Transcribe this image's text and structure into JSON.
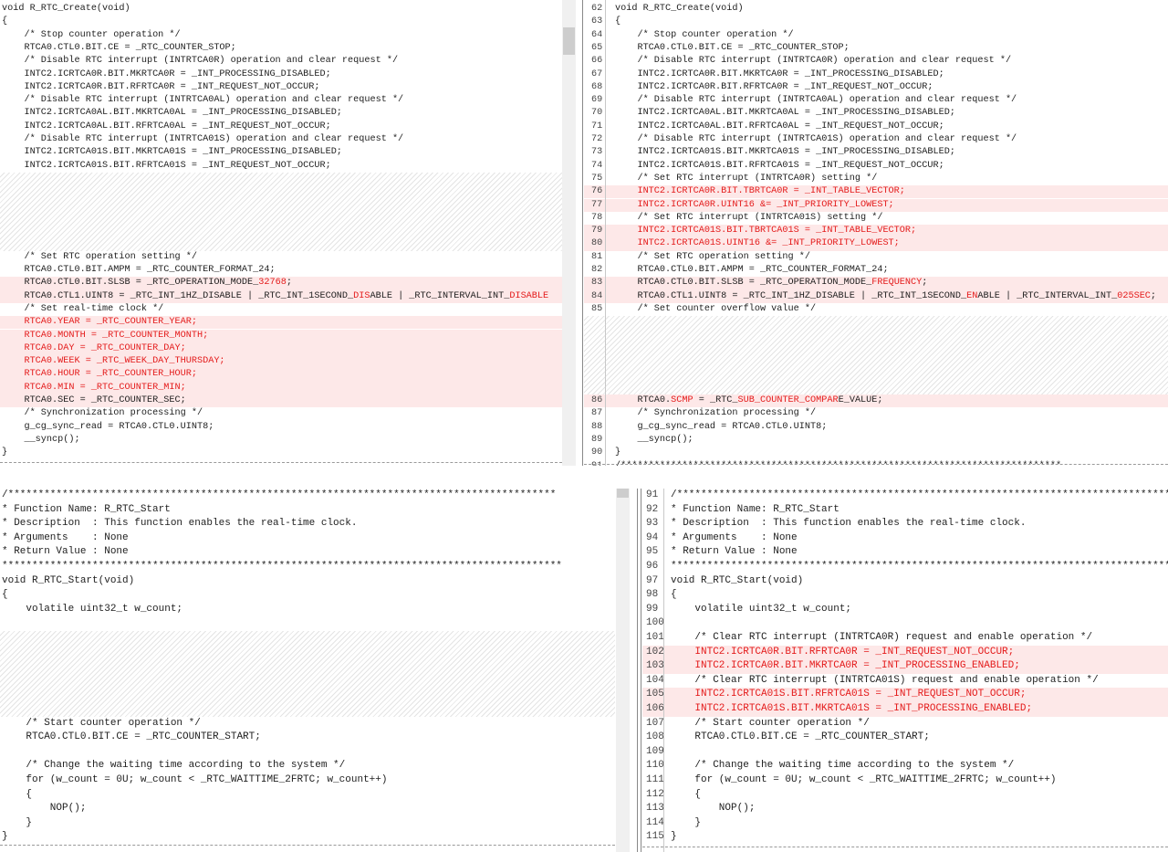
{
  "top_left": [
    {
      "t": "void R_RTC_Create(void)"
    },
    {
      "t": "{"
    },
    {
      "t": "    /* Stop counter operation */"
    },
    {
      "t": "    RTCA0.CTL0.BIT.CE = _RTC_COUNTER_STOP;"
    },
    {
      "t": "    /* Disable RTC interrupt (INTRTCA0R) operation and clear request */"
    },
    {
      "t": "    INTC2.ICRTCA0R.BIT.MKRTCA0R = _INT_PROCESSING_DISABLED;"
    },
    {
      "t": "    INTC2.ICRTCA0R.BIT.RFRTCA0R = _INT_REQUEST_NOT_OCCUR;"
    },
    {
      "t": "    /* Disable RTC interrupt (INTRTCA0AL) operation and clear request */"
    },
    {
      "t": "    INTC2.ICRTCA0AL.BIT.MKRTCA0AL = _INT_PROCESSING_DISABLED;"
    },
    {
      "t": "    INTC2.ICRTCA0AL.BIT.RFRTCA0AL = _INT_REQUEST_NOT_OCCUR;"
    },
    {
      "t": "    /* Disable RTC interrupt (INTRTCA01S) operation and clear request */"
    },
    {
      "t": "    INTC2.ICRTCA01S.BIT.MKRTCA01S = _INT_PROCESSING_DISABLED;"
    },
    {
      "t": "    INTC2.ICRTCA01S.BIT.RFRTCA01S = _INT_REQUEST_NOT_OCCUR;"
    },
    {
      "gap": 6
    },
    {
      "t": "    /* Set RTC operation setting */"
    },
    {
      "t": "    RTCA0.CTL0.BIT.AMPM = _RTC_COUNTER_FORMAT_24;"
    },
    {
      "d": 1,
      "p": [
        "    RTCA0.CTL0.BIT.SLSB = _RTC_OPERATION_MODE_",
        [
          "32768",
          1
        ],
        ";"
      ]
    },
    {
      "d": 1,
      "p": [
        "    RTCA0.CTL1.UINT8 = _RTC_INT_1HZ_DISABLE | _RTC_INT_1SECOND_",
        [
          "DIS",
          1
        ],
        "ABLE | _RTC_INTERVAL_INT_",
        [
          "DISABLE",
          1
        ]
      ]
    },
    {
      "t": "    /* Set real-time clock */"
    },
    {
      "d": 1,
      "p": [
        [
          "    RTCA0.YEAR = _RTC_COUNTER_YEAR;",
          1
        ]
      ]
    },
    {
      "d": 1,
      "p": [
        [
          "    RTCA0.MONTH = _RTC_COUNTER_MONTH;",
          1
        ]
      ]
    },
    {
      "d": 1,
      "p": [
        [
          "    RTCA0.DAY = _RTC_COUNTER_DAY;",
          1
        ]
      ]
    },
    {
      "d": 1,
      "p": [
        [
          "    RTCA0.WEEK = _RTC_WEEK_DAY_THURSDAY;",
          1
        ]
      ]
    },
    {
      "d": 1,
      "p": [
        [
          "    RTCA0.HOUR = _RTC_COUNTER_HOUR;",
          1
        ]
      ]
    },
    {
      "d": 1,
      "p": [
        [
          "    RTCA0.MIN = _RTC_COUNTER_MIN;",
          1
        ]
      ]
    },
    {
      "d": 1,
      "p": [
        "    RTCA0.",
        [
          "SEC = _RTC_COUNTER_SEC;",
          0
        ]
      ]
    },
    {
      "t": "    /* Synchronization processing */"
    },
    {
      "t": "    g_cg_sync_read = RTCA0.CTL0.UINT8;"
    },
    {
      "t": "    __syncp();"
    },
    {
      "t": "}"
    }
  ],
  "top_right": [
    {
      "n": "62",
      "t": "void R_RTC_Create(void)"
    },
    {
      "n": "63",
      "t": "{"
    },
    {
      "n": "64",
      "t": "    /* Stop counter operation */"
    },
    {
      "n": "65",
      "t": "    RTCA0.CTL0.BIT.CE = _RTC_COUNTER_STOP;"
    },
    {
      "n": "66",
      "t": "    /* Disable RTC interrupt (INTRTCA0R) operation and clear request */"
    },
    {
      "n": "67",
      "t": "    INTC2.ICRTCA0R.BIT.MKRTCA0R = _INT_PROCESSING_DISABLED;"
    },
    {
      "n": "68",
      "t": "    INTC2.ICRTCA0R.BIT.RFRTCA0R = _INT_REQUEST_NOT_OCCUR;"
    },
    {
      "n": "69",
      "t": "    /* Disable RTC interrupt (INTRTCA0AL) operation and clear request */"
    },
    {
      "n": "70",
      "t": "    INTC2.ICRTCA0AL.BIT.MKRTCA0AL = _INT_PROCESSING_DISABLED;"
    },
    {
      "n": "71",
      "t": "    INTC2.ICRTCA0AL.BIT.RFRTCA0AL = _INT_REQUEST_NOT_OCCUR;"
    },
    {
      "n": "72",
      "t": "    /* Disable RTC interrupt (INTRTCA01S) operation and clear request */"
    },
    {
      "n": "73",
      "t": "    INTC2.ICRTCA01S.BIT.MKRTCA01S = _INT_PROCESSING_DISABLED;"
    },
    {
      "n": "74",
      "t": "    INTC2.ICRTCA01S.BIT.RFRTCA01S = _INT_REQUEST_NOT_OCCUR;"
    },
    {
      "n": "75",
      "t": "    /* Set RTC interrupt (INTRTCA0R) setting */"
    },
    {
      "n": "76",
      "d": 1,
      "p": [
        [
          "    INTC2.ICRTCA0R.BIT.TBRTCA0R = _INT_TABLE_VECTOR;",
          1
        ]
      ]
    },
    {
      "n": "77",
      "d": 1,
      "p": [
        [
          "    INTC2.ICRTCA0R.UINT16 &= _INT_PRIORITY_LOWEST;",
          1
        ]
      ]
    },
    {
      "n": "78",
      "t": "    /* Set RTC interrupt (INTRTCA01S) setting */"
    },
    {
      "n": "79",
      "d": 1,
      "p": [
        [
          "    INTC2.ICRTCA01S.BIT.TBRTCA01S = _INT_TABLE_VECTOR;",
          1
        ]
      ]
    },
    {
      "n": "80",
      "d": 1,
      "p": [
        [
          "    INTC2.ICRTCA01S.UINT16 &= _INT_PRIORITY_LOWEST;",
          1
        ]
      ]
    },
    {
      "n": "81",
      "t": "    /* Set RTC operation setting */"
    },
    {
      "n": "82",
      "t": "    RTCA0.CTL0.BIT.AMPM = _RTC_COUNTER_FORMAT_24;"
    },
    {
      "n": "83",
      "d": 1,
      "p": [
        "    RTCA0.CTL0.BIT.SLSB = _RTC_OPERATION_MODE_",
        [
          "FREQUENCY",
          1
        ],
        ";"
      ]
    },
    {
      "n": "84",
      "d": 1,
      "p": [
        "    RTCA0.CTL1.UINT8 = _RTC_INT_1HZ_DISABLE | _RTC_INT_1SECOND_",
        [
          "EN",
          1
        ],
        "ABLE | _RTC_INTERVAL_INT_",
        [
          "025SEC",
          1
        ],
        ";"
      ]
    },
    {
      "n": "85",
      "t": "    /* Set counter overflow value */"
    },
    {
      "gap": 6
    },
    {
      "n": "86",
      "d": 1,
      "p": [
        "    RTCA0.",
        [
          "SCMP",
          1
        ],
        " = _RTC_",
        [
          "SUB_COUNTER_",
          1
        ],
        [
          "COMPAR",
          1
        ],
        "E_",
        [
          "VALUE",
          0
        ],
        ";"
      ]
    },
    {
      "n": "87",
      "t": "    /* Synchronization processing */"
    },
    {
      "n": "88",
      "t": "    g_cg_sync_read = RTCA0.CTL0.UINT8;"
    },
    {
      "n": "89",
      "t": "    __syncp();"
    },
    {
      "n": "90",
      "t": "}"
    },
    {
      "n": "91",
      "t": "/*******************************************************************************"
    }
  ],
  "bottom_left": [
    {
      "t": "/*******************************************************************************************"
    },
    {
      "t": "* Function Name: R_RTC_Start"
    },
    {
      "t": "* Description  : This function enables the real-time clock."
    },
    {
      "t": "* Arguments    : None"
    },
    {
      "t": "* Return Value : None"
    },
    {
      "t": "*********************************************************************************************"
    },
    {
      "t": "void R_RTC_Start(void)"
    },
    {
      "t": "{"
    },
    {
      "t": "    volatile uint32_t w_count;"
    },
    {
      "t": ""
    },
    {
      "gap": 6
    },
    {
      "t": "    /* Start counter operation */"
    },
    {
      "t": "    RTCA0.CTL0.BIT.CE = _RTC_COUNTER_START;"
    },
    {
      "t": ""
    },
    {
      "t": "    /* Change the waiting time according to the system */"
    },
    {
      "t": "    for (w_count = 0U; w_count < _RTC_WAITTIME_2FRTC; w_count++)"
    },
    {
      "t": "    {"
    },
    {
      "t": "        NOP();"
    },
    {
      "t": "    }"
    },
    {
      "t": "}"
    }
  ],
  "bottom_right": [
    {
      "n": "91",
      "t": "/*******************************************************************************************"
    },
    {
      "n": "92",
      "t": "* Function Name: R_RTC_Start"
    },
    {
      "n": "93",
      "t": "* Description  : This function enables the real-time clock."
    },
    {
      "n": "94",
      "t": "* Arguments    : None"
    },
    {
      "n": "95",
      "t": "* Return Value : None"
    },
    {
      "n": "96",
      "t": "*********************************************************************************************"
    },
    {
      "n": "97",
      "t": "void R_RTC_Start(void)"
    },
    {
      "n": "98",
      "t": "{"
    },
    {
      "n": "99",
      "t": "    volatile uint32_t w_count;"
    },
    {
      "n": "100",
      "t": ""
    },
    {
      "n": "101",
      "t": "    /* Clear RTC interrupt (INTRTCA0R) request and enable operation */"
    },
    {
      "n": "102",
      "d": 1,
      "p": [
        [
          "    INTC2.ICRTCA0R.BIT.RFRTCA0R = _INT_REQUEST_NOT_OCCUR;",
          1
        ]
      ]
    },
    {
      "n": "103",
      "d": 1,
      "p": [
        [
          "    INTC2.ICRTCA0R.BIT.MKRTCA0R = _INT_PROCESSING_ENABLED;",
          1
        ]
      ]
    },
    {
      "n": "104",
      "t": "    /* Clear RTC interrupt (INTRTCA01S) request and enable operation */"
    },
    {
      "n": "105",
      "d": 1,
      "p": [
        [
          "    INTC2.ICRTCA01S.BIT.RFRTCA01S = _INT_REQUEST_NOT_OCCUR;",
          1
        ]
      ]
    },
    {
      "n": "106",
      "d": 1,
      "p": [
        [
          "    INTC2.ICRTCA01S.BIT.MKRTCA01S = _INT_PROCESSING_ENABLED;",
          1
        ]
      ]
    },
    {
      "n": "107",
      "t": "    /* Start counter operation */"
    },
    {
      "n": "108",
      "t": "    RTCA0.CTL0.BIT.CE = _RTC_COUNTER_START;"
    },
    {
      "n": "109",
      "t": ""
    },
    {
      "n": "110",
      "t": "    /* Change the waiting time according to the system */"
    },
    {
      "n": "111",
      "t": "    for (w_count = 0U; w_count < _RTC_WAITTIME_2FRTC; w_count++)"
    },
    {
      "n": "112",
      "t": "    {"
    },
    {
      "n": "113",
      "t": "        NOP();"
    },
    {
      "n": "114",
      "t": "    }"
    },
    {
      "n": "115",
      "t": "}"
    }
  ]
}
